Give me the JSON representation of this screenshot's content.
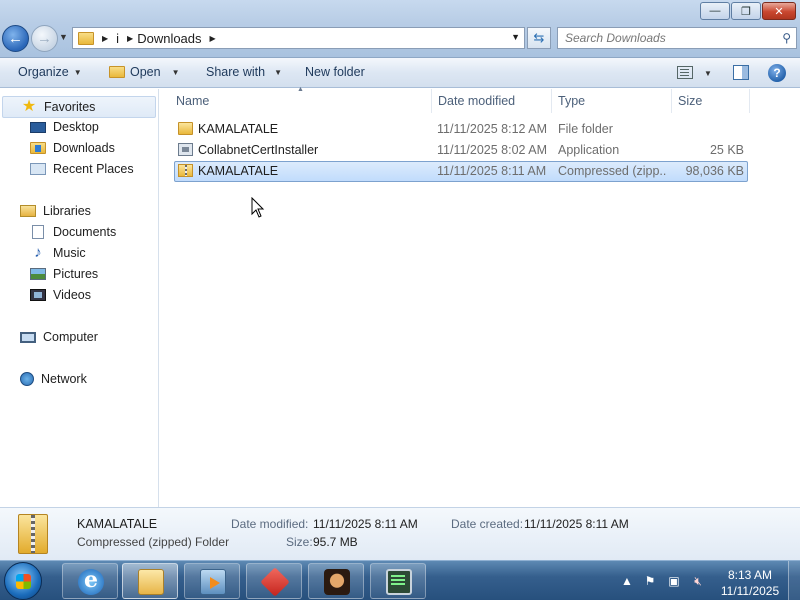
{
  "window": {
    "controls": [
      "minimize",
      "maximize",
      "close"
    ]
  },
  "address": {
    "crumbs": [
      "i",
      "Downloads"
    ],
    "search_placeholder": "Search Downloads"
  },
  "toolbar": {
    "organize": "Organize",
    "open": "Open",
    "share_with": "Share with",
    "new_folder": "New folder"
  },
  "navpane": {
    "favorites": "Favorites",
    "desktop": "Desktop",
    "downloads": "Downloads",
    "recent_places": "Recent Places",
    "libraries": "Libraries",
    "documents": "Documents",
    "music": "Music",
    "pictures": "Pictures",
    "videos": "Videos",
    "computer": "Computer",
    "network": "Network"
  },
  "columns": {
    "name": "Name",
    "date_modified": "Date modified",
    "type": "Type",
    "size": "Size"
  },
  "files": [
    {
      "name": "KAMALATALE",
      "date": "11/11/2025 8:12 AM",
      "type": "File folder",
      "size": "",
      "icon": "folder-icon"
    },
    {
      "name": "CollabnetCertInstaller",
      "date": "11/11/2025 8:02 AM",
      "type": "Application",
      "size": "25 KB",
      "icon": "application-icon"
    },
    {
      "name": "KAMALATALE",
      "date": "11/11/2025 8:11 AM",
      "type": "Compressed (zipp...",
      "size": "98,036 KB",
      "icon": "zip-folder-icon"
    }
  ],
  "details": {
    "name": "KAMALATALE",
    "type": "Compressed (zipped) Folder",
    "date_modified_label": "Date modified:",
    "date_modified": "11/11/2025 8:11 AM",
    "date_created_label": "Date created:",
    "date_created": "11/11/2025 8:11 AM",
    "size_label": "Size:",
    "size": "95.7 MB"
  },
  "taskbar": {
    "time": "8:13 AM",
    "date": "11/11/2025"
  },
  "colors": {
    "selection": "#cce4fc",
    "taskbar": "#2c5684",
    "close_button": "#c9472f"
  }
}
